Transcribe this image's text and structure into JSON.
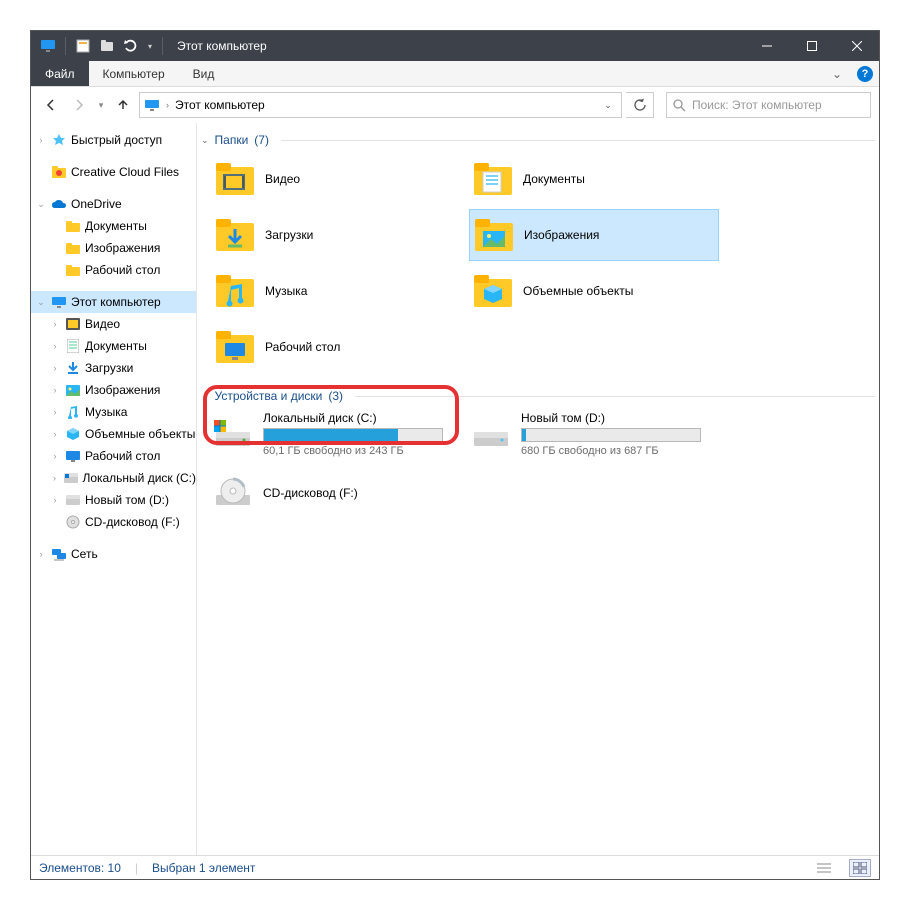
{
  "title": "Этот компьютер",
  "ribbon": {
    "file": "Файл",
    "tabs": [
      "Компьютер",
      "Вид"
    ]
  },
  "address": {
    "location": "Этот компьютер"
  },
  "search": {
    "placeholder": "Поиск: Этот компьютер"
  },
  "tree": {
    "quick_access": "Быстрый доступ",
    "creative_cloud": "Creative Cloud Files",
    "onedrive": "OneDrive",
    "onedrive_children": [
      "Документы",
      "Изображения",
      "Рабочий стол"
    ],
    "this_pc": "Этот компьютер",
    "this_pc_children": [
      "Видео",
      "Документы",
      "Загрузки",
      "Изображения",
      "Музыка",
      "Объемные объекты",
      "Рабочий стол",
      "Локальный диск (C:)",
      "Новый том (D:)",
      "CD-дисковод (F:)"
    ],
    "network": "Сеть"
  },
  "groups": {
    "folders": {
      "title": "Папки",
      "count": "(7)"
    },
    "drives": {
      "title": "Устройства и диски",
      "count": "(3)"
    }
  },
  "folders": [
    {
      "name": "Видео",
      "icon": "video"
    },
    {
      "name": "Документы",
      "icon": "docs"
    },
    {
      "name": "Загрузки",
      "icon": "downloads"
    },
    {
      "name": "Изображения",
      "icon": "pictures",
      "selected": true
    },
    {
      "name": "Музыка",
      "icon": "music"
    },
    {
      "name": "Объемные объекты",
      "icon": "3d"
    },
    {
      "name": "Рабочий стол",
      "icon": "desktop"
    }
  ],
  "drives": [
    {
      "name": "Локальный диск (C:)",
      "free": "60,1 ГБ свободно из 243 ГБ",
      "used_pct": 75,
      "highlight": true,
      "icon": "os-drive"
    },
    {
      "name": "Новый том (D:)",
      "free": "680 ГБ свободно из 687 ГБ",
      "used_pct": 2,
      "icon": "drive"
    },
    {
      "name": "CD-дисковод (F:)",
      "free": "",
      "used_pct": null,
      "icon": "cd"
    }
  ],
  "status": {
    "items": "Элементов: 10",
    "selected": "Выбран 1 элемент"
  }
}
